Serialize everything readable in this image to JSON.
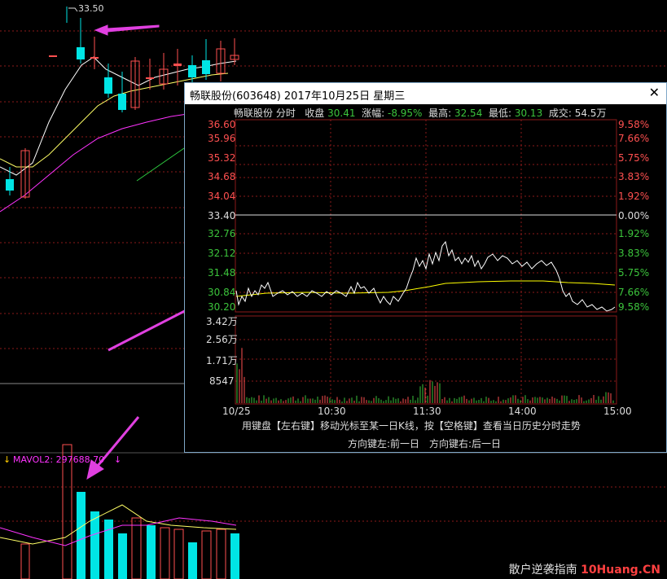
{
  "main_chart": {
    "high_label": "33.50",
    "mavol_label": "MAVOL2: 297688.70",
    "arrow_down_1": "↓",
    "arrow_down_2": "↓"
  },
  "popup": {
    "title": "畅联股份(603648) 2017年10月25日 星期三",
    "close_label": "✕",
    "info": {
      "name": "畅联股份 分时",
      "close_label": "收盘",
      "close_value": "30.41",
      "change_label": "涨幅:",
      "change_value": "-8.95%",
      "high_label": "最高:",
      "high_value": "32.54",
      "low_label": "最低:",
      "low_value": "30.13",
      "vol_label": "成交:",
      "vol_value": "54.5万"
    },
    "price_ticks": [
      "36.60",
      "35.96",
      "35.32",
      "34.68",
      "34.04",
      "33.40",
      "32.76",
      "32.12",
      "31.48",
      "30.84",
      "30.20"
    ],
    "pct_ticks": [
      "9.58%",
      "7.66%",
      "5.75%",
      "3.83%",
      "1.92%",
      "0.00%",
      "1.92%",
      "3.83%",
      "5.75%",
      "7.66%",
      "9.58%"
    ],
    "vol_ticks": [
      "3.42万",
      "2.56万",
      "1.71万",
      "8547"
    ],
    "time_ticks": [
      "10/25",
      "10:30",
      "11:30",
      "14:00",
      "15:00"
    ],
    "hint_line1": "用键盘【左右键】移动光标至某一日K线，按【空格键】查看当日历史分时走势",
    "hint_line2_left": "方向键左:前一日",
    "hint_line2_right": "方向键右:后一日"
  },
  "watermark": {
    "text": "散户逆袭指南",
    "brand": "10Huang.CN"
  },
  "colors": {
    "up": "#ff5050",
    "down": "#00e5e5",
    "ma1": "#ffffff",
    "ma2": "#ffff66",
    "ma3": "#ff33ff",
    "arrow": "#e040e0",
    "price_line": "#ffffff",
    "avg_line": "#ffff00",
    "grid": "#8b1a1a"
  }
}
